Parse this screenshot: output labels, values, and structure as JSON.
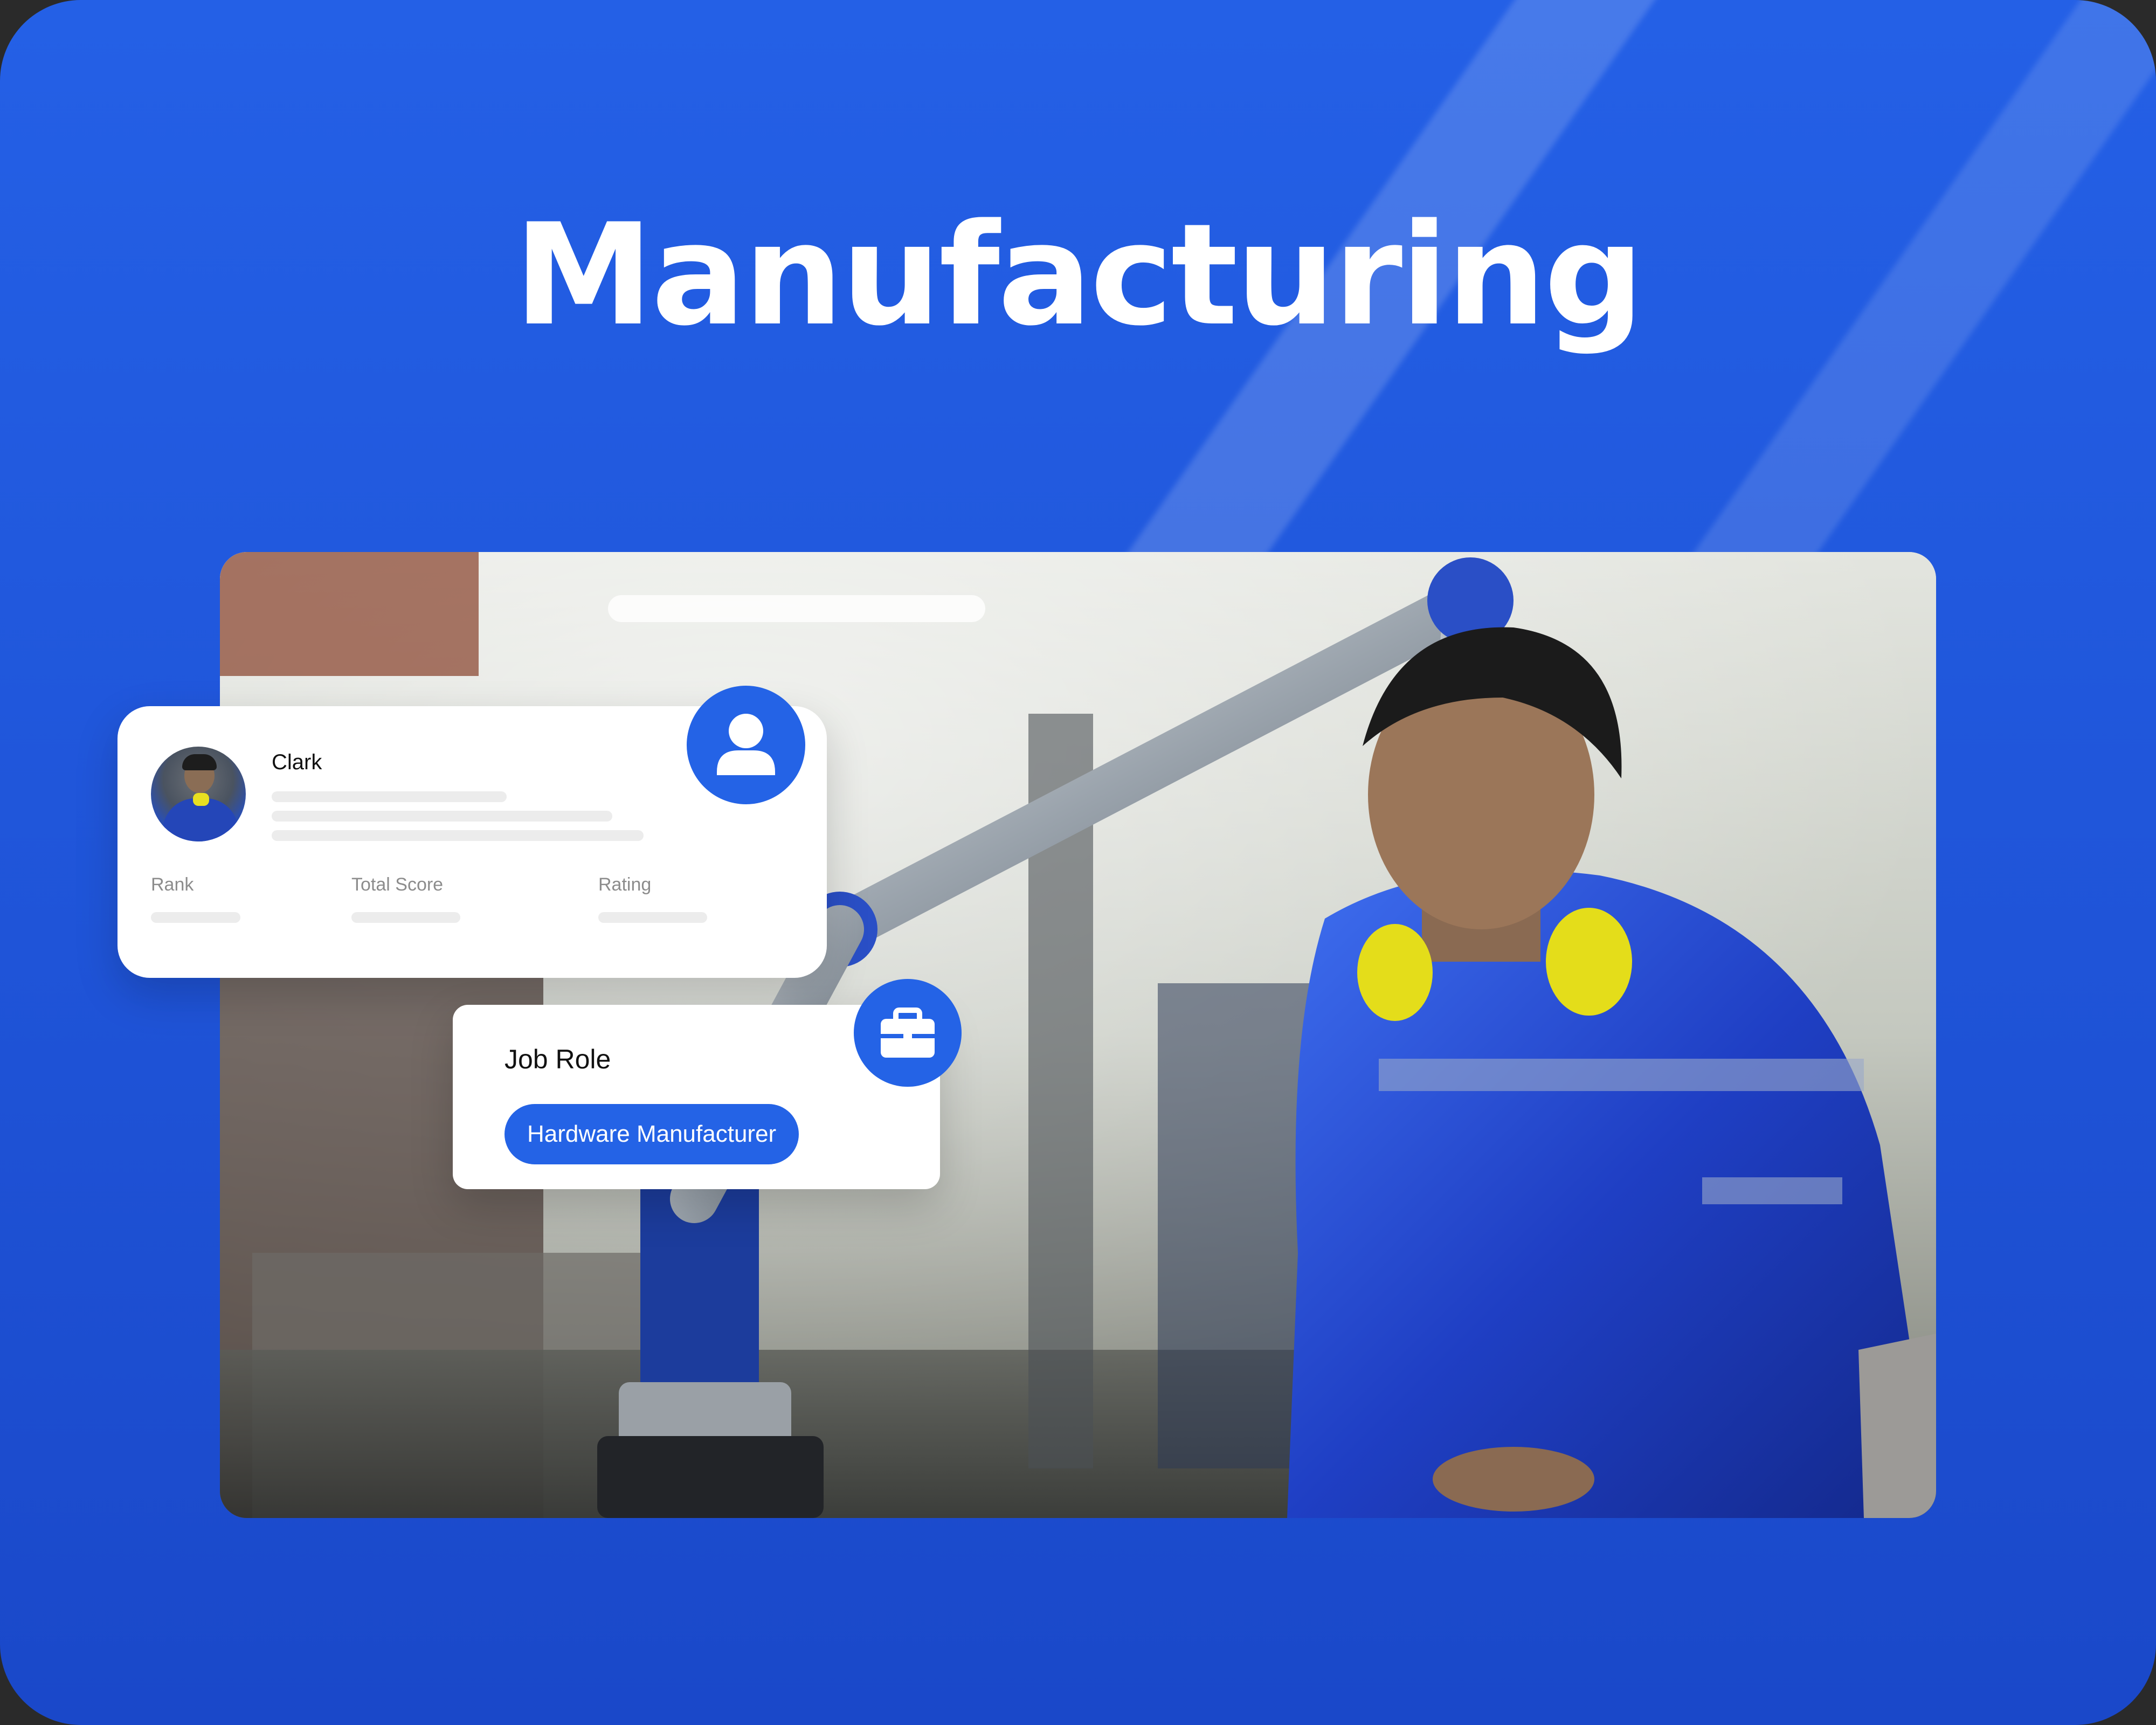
{
  "page": {
    "title": "Manufacturing"
  },
  "profile_card": {
    "name": "Clark",
    "stats": [
      {
        "label": "Rank"
      },
      {
        "label": "Total Score"
      },
      {
        "label": "Rating"
      }
    ],
    "badge_icon": "user-icon"
  },
  "role_card": {
    "title": "Job Role",
    "chip_label": "Hardware Manufacturer",
    "badge_icon": "briefcase-icon"
  },
  "colors": {
    "background": "#2460e6",
    "accent": "#2463e6",
    "card": "#ffffff",
    "title_text": "#ffffff"
  }
}
